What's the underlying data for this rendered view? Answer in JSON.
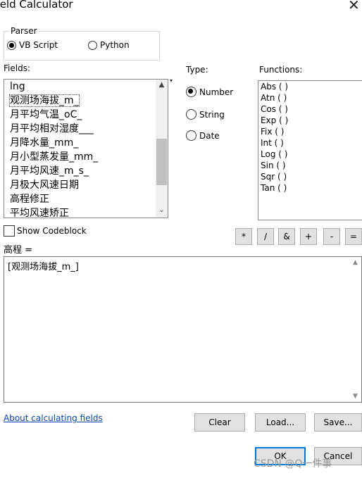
{
  "window": {
    "title": "Field Calculator",
    "close_glyph": "✕"
  },
  "parser": {
    "label": "Parser",
    "options": [
      {
        "label": "VB Script",
        "selected": true
      },
      {
        "label": "Python",
        "selected": false
      }
    ]
  },
  "fields": {
    "label": "Fields:",
    "items": [
      "lng",
      "观测场海拔_m_",
      "月平均气温_oC_",
      "月平均相对湿度___",
      "月降水量_mm_",
      "月小型蒸发量_mm_",
      "月平均风速_m_s_",
      "月极大风速日期",
      "高程修正",
      "平均风速矫正"
    ],
    "selected_index": 1
  },
  "type": {
    "label": "Type:",
    "options": [
      {
        "label": "Number",
        "selected": true
      },
      {
        "label": "String",
        "selected": false
      },
      {
        "label": "Date",
        "selected": false
      }
    ]
  },
  "functions": {
    "label": "Functions:",
    "items": [
      "Abs ( )",
      "Atn ( )",
      "Cos ( )",
      "Exp ( )",
      "Fix ( )",
      "Int ( )",
      "Log ( )",
      "Sin ( )",
      "Sqr ( )",
      "Tan ( )"
    ]
  },
  "operators": [
    "*",
    "/",
    "&",
    "+",
    "-",
    "="
  ],
  "codeblock": {
    "label": "Show Codeblock",
    "checked": false
  },
  "expression": {
    "label": "高程 =",
    "value": "[观测场海拔_m_]"
  },
  "links": {
    "about": "About calculating fields"
  },
  "buttons": {
    "clear": "Clear",
    "load": "Load...",
    "save": "Save...",
    "ok": "OK",
    "cancel": "Cancel"
  },
  "watermark": "CSDN @Q一件事"
}
